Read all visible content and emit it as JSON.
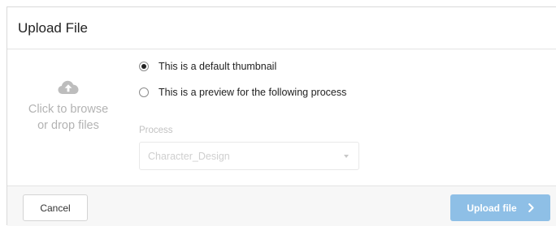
{
  "dialog": {
    "title": "Upload File"
  },
  "dropzone": {
    "icon": "cloud-upload-icon",
    "hint_line1": "Click to browse",
    "hint_line2": "or drop files"
  },
  "options": {
    "items": [
      {
        "label": "This is a default thumbnail",
        "checked": true
      },
      {
        "label": "This is a preview for the following process",
        "checked": false
      }
    ],
    "process_label": "Process",
    "process_value": "Character_Design"
  },
  "footer": {
    "cancel_label": "Cancel",
    "upload_label": "Upload file",
    "upload_icon": "chevron-right-icon"
  },
  "colors": {
    "upload_button": "#8ebfe6",
    "footer_bg": "#f7f7f7",
    "hint_text": "#b3b3b3"
  }
}
